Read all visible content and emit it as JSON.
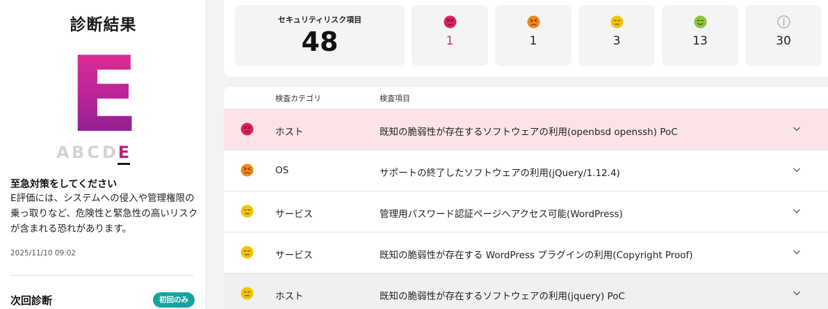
{
  "left_panel": {
    "title": "診断結果",
    "grade": "E",
    "grade_scale": [
      "A",
      "B",
      "C",
      "D",
      "E"
    ],
    "active_grade": "E",
    "advice_title": "至急対策をしてください",
    "advice_body": "E評価には、システムへの侵入や管理権限の乗っ取りなど、危険性と緊急性の高いリスクが含まれる恐れがあります。",
    "timestamp": "2025/11/10 09:02",
    "next_diagnosis_label": "次回診断",
    "first_time_badge": "初回のみ"
  },
  "summary": {
    "total_label": "セキュリティリスク項目",
    "total_count": "48",
    "levels": [
      {
        "level": "critical",
        "icon": "critical-face-icon",
        "color": "#d9245f",
        "count": "1"
      },
      {
        "level": "high",
        "icon": "high-face-icon",
        "color": "#ee8a1c",
        "count": "1"
      },
      {
        "level": "medium",
        "icon": "medium-face-icon",
        "color": "#f2c40c",
        "count": "3"
      },
      {
        "level": "low",
        "icon": "low-face-icon",
        "color": "#8cc43b",
        "count": "13"
      },
      {
        "level": "info",
        "icon": "info-icon",
        "color": "#bdbdbd",
        "count": "30"
      }
    ]
  },
  "table": {
    "headers": {
      "category": "検査カテゴリ",
      "item": "検査項目"
    },
    "rows": [
      {
        "severity": "critical",
        "icon": "critical-face-icon",
        "category": "ホスト",
        "item": "既知の脆弱性が存在するソフトウェアの利用(openbsd openssh) PoC"
      },
      {
        "severity": "high",
        "icon": "high-face-icon",
        "category": "OS",
        "item": "サポートの終了したソフトウェアの利用(jQuery/1.12.4)"
      },
      {
        "severity": "medium",
        "icon": "medium-face-icon",
        "category": "サービス",
        "item": "管理用パスワード認証ページへアクセス可能(WordPress)"
      },
      {
        "severity": "medium",
        "icon": "medium-face-icon",
        "category": "サービス",
        "item": "既知の脆弱性が存在する WordPress プラグインの利用(Copyright Proof)"
      },
      {
        "severity": "medium",
        "icon": "medium-face-icon",
        "category": "ホスト",
        "item": "既知の脆弱性が存在するソフトウェアの利用(jquery) PoC"
      }
    ]
  },
  "colors": {
    "critical": "#d9245f",
    "high": "#ee8a1c",
    "medium": "#f2c40c",
    "low": "#8cc43b",
    "info": "#bdbdbd",
    "badge": "#17a3a0",
    "critical_row_bg": "#fbe3e7"
  }
}
